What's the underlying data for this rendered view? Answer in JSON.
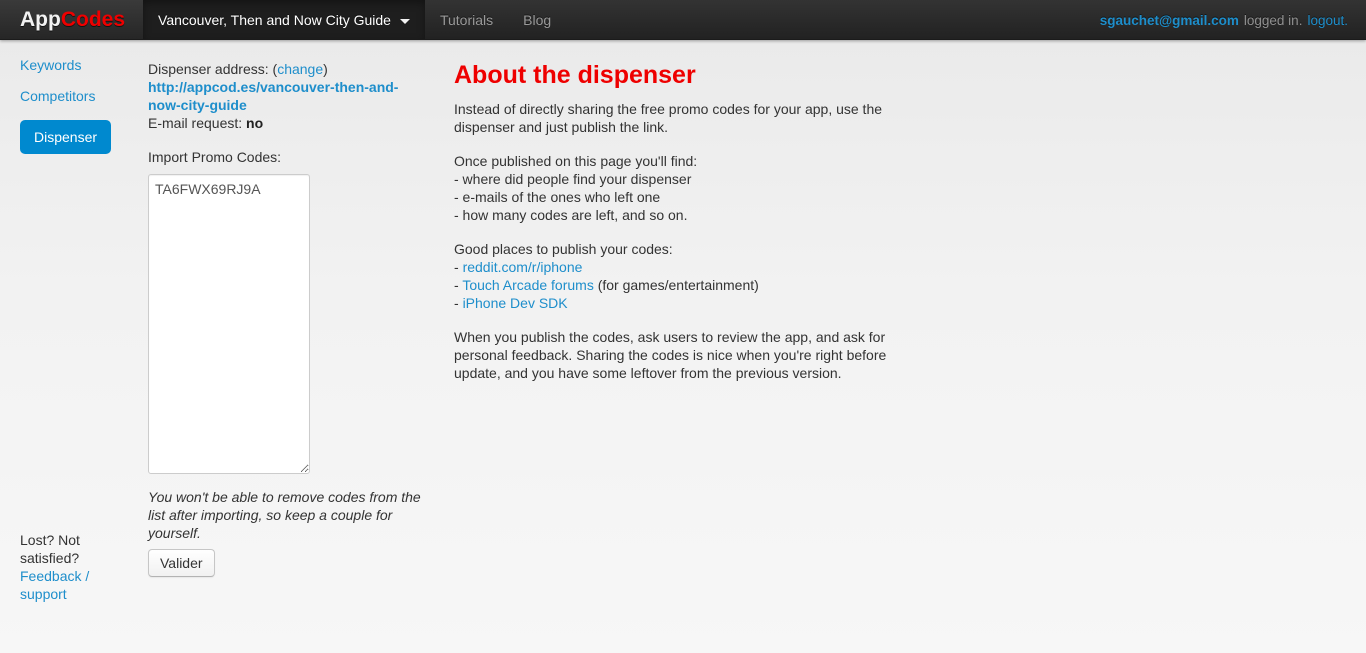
{
  "navbar": {
    "brand_first": "App",
    "brand_second": "Codes",
    "app_selector": "Vancouver, Then and Now City Guide",
    "caret_icon": "chevron-down-icon",
    "items": [
      {
        "label": "Tutorials"
      },
      {
        "label": "Blog"
      }
    ],
    "account": {
      "email": "sgauchet@gmail.com",
      "status": "logged in.",
      "logout": "logout."
    }
  },
  "sidebar": {
    "items": [
      {
        "label": "Keywords",
        "active": false
      },
      {
        "label": "Competitors",
        "active": false
      },
      {
        "label": "Dispenser",
        "active": true
      }
    ],
    "help": {
      "line1": "Lost? Not",
      "line2": "satisfied?",
      "link1": "Feedback /",
      "link2": "support"
    }
  },
  "dispenser": {
    "address_label": "Dispenser address:",
    "change_open": "(",
    "change_label": "change",
    "change_close": ")",
    "url_line1": "http://appcod.es/vancouver-then-and-",
    "url_line2": "now-city-guide",
    "email_request_label": "E-mail request:",
    "email_request_value": "no",
    "import_label": "Import Promo Codes:",
    "textarea_value": "TA6FWX69RJ9A",
    "textarea_placeholder": "",
    "note_line1": "You won't be able to remove codes from the",
    "note_line2": "list after importing, so keep a couple for",
    "note_line3": "yourself.",
    "submit_label": "Valider"
  },
  "about": {
    "title": "About the dispenser",
    "intro_line1": "Instead of directly sharing the free promo codes for your app, use the",
    "intro_line2": "dispenser and just publish the link.",
    "find_heading": "Once published on this page you'll find:",
    "find_items": [
      "- where did people find your dispenser",
      "- e-mails of the ones who left one",
      "- how many codes are left, and so on."
    ],
    "publish_heading": "Good places to publish your codes:",
    "publish_links": [
      {
        "dash": "- ",
        "label": "reddit.com/r/iphone",
        "suffix": ""
      },
      {
        "dash": "- ",
        "label": "Touch Arcade forums",
        "suffix": " (for games/entertainment)"
      },
      {
        "dash": "- ",
        "label": "iPhone Dev SDK",
        "suffix": ""
      }
    ],
    "closing_line1": "When you publish the codes, ask users to review the app, and ask for",
    "closing_line2": "personal feedback. Sharing the codes is nice when you're right before",
    "closing_line3": "update, and you have some leftover from the previous version."
  },
  "colors": {
    "brand_red": "#ee0000",
    "link_blue": "#1e8ecb",
    "active_blue": "#0089cf",
    "navbar_dark": "#222222"
  }
}
